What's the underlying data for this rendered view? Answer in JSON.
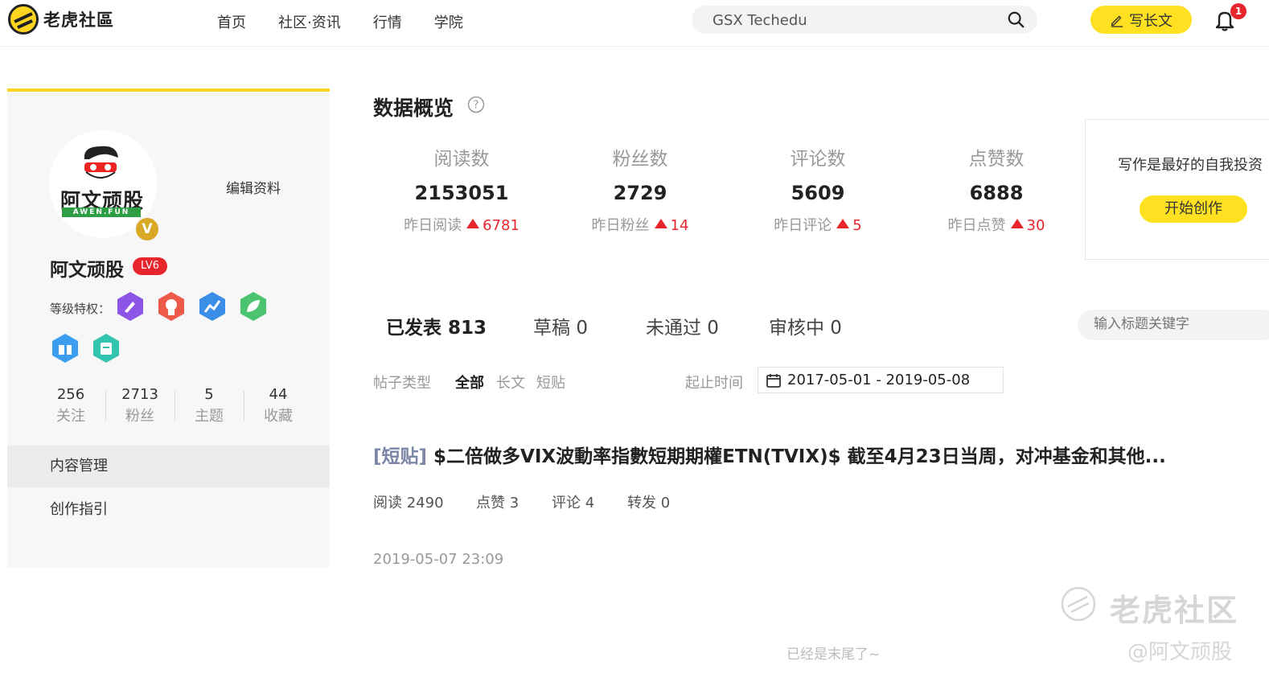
{
  "header": {
    "logo_text": "老虎社區",
    "nav": [
      "首页",
      "社区·资讯",
      "行情",
      "学院"
    ],
    "search_value": "GSX Techedu",
    "write_label": "写长文",
    "notification_count": "1"
  },
  "profile": {
    "avatar_text": "阿文顽股",
    "avatar_sub": "AWEN.FUN",
    "verified": "V",
    "edit_label": "编辑资料",
    "name": "阿文顽股",
    "level": "LV6",
    "privilege_label": "等级特权：",
    "privilege_icons": [
      "edit-privilege-icon",
      "medal-privilege-icon",
      "chart-privilege-icon",
      "leaf-privilege-icon",
      "gift-privilege-icon",
      "document-privilege-icon"
    ],
    "stats": [
      {
        "num": "256",
        "label": "关注"
      },
      {
        "num": "2713",
        "label": "粉丝"
      },
      {
        "num": "5",
        "label": "主题"
      },
      {
        "num": "44",
        "label": "收藏"
      }
    ],
    "menu": [
      "内容管理",
      "创作指引"
    ]
  },
  "overview": {
    "title": "数据概览",
    "metrics": [
      {
        "label": "阅读数",
        "value": "2153051",
        "sub_label": "昨日阅读",
        "sub_value": "6781"
      },
      {
        "label": "粉丝数",
        "value": "2729",
        "sub_label": "昨日粉丝",
        "sub_value": "14"
      },
      {
        "label": "评论数",
        "value": "5609",
        "sub_label": "昨日评论",
        "sub_value": "5"
      },
      {
        "label": "点赞数",
        "value": "6888",
        "sub_label": "昨日点赞",
        "sub_value": "30"
      }
    ],
    "promo_text": "写作是最好的自我投资",
    "promo_button": "开始创作"
  },
  "posts": {
    "tabs": [
      "已发表 813",
      "草稿 0",
      "未通过 0",
      "审核中 0"
    ],
    "search_placeholder": "输入标题关键字",
    "type_label": "帖子类型",
    "type_options": [
      "全部",
      "长文",
      "短贴"
    ],
    "time_label": "起止时间",
    "date_range": "2017-05-01 - 2019-05-08",
    "items": [
      {
        "tag": "[短贴]",
        "title": " $二倍做多VIX波動率指數短期期權ETN(TVIX)$ 截至4月23日当周，对冲基金和其他...",
        "meta": [
          "阅读 2490",
          "点赞 3",
          "评论 4",
          "转发 0"
        ],
        "date": "2019-05-07 23:09"
      }
    ],
    "end_text": "已经是末尾了~"
  },
  "watermark": {
    "brand": "老虎社区",
    "author": "@阿文顽股"
  },
  "colors": {
    "accent_yellow": "#ffe121",
    "increase_red": "#e8252c",
    "tag_gray_blue": "#7c86a6"
  }
}
